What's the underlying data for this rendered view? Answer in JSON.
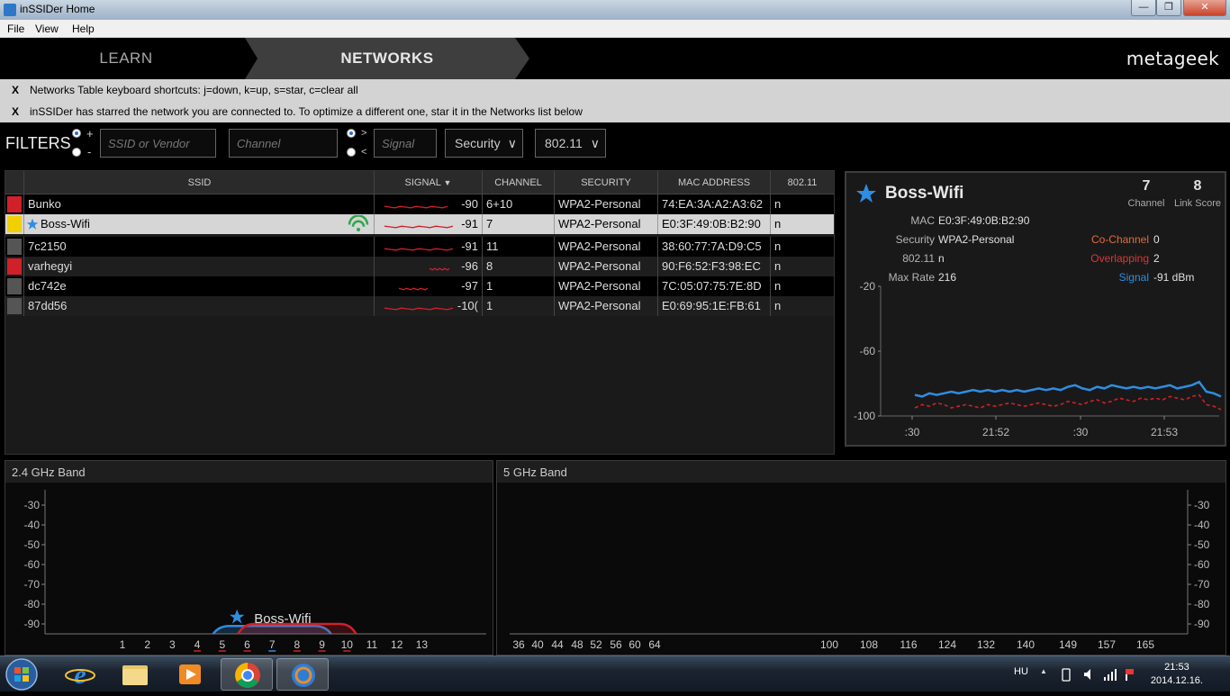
{
  "window": {
    "title": "inSSIDer Home",
    "controls": {
      "minimize": "—",
      "maximize": "❐",
      "close": "✕"
    }
  },
  "menu": [
    "File",
    "View",
    "Help"
  ],
  "nav": {
    "learn": "LEARN",
    "networks": "NETWORKS",
    "brand": "metageek"
  },
  "notices": [
    {
      "close": "X",
      "text": "Networks Table keyboard shortcuts: j=down, k=up, s=star, c=clear all"
    },
    {
      "close": "X",
      "text": "inSSIDer has starred the network you are connected to. To optimize a different one, star it in the Networks list below"
    }
  ],
  "filters": {
    "label": "FILTERS",
    "plus": "+",
    "minus": "-",
    "gt": ">",
    "lt": "<",
    "ssid_placeholder": "SSID or Vendor",
    "channel_placeholder": "Channel",
    "signal_placeholder": "Signal",
    "security": "Security",
    "standard": "802.11",
    "dropdown_arrow": "∨"
  },
  "table": {
    "headers": {
      "ssid": "SSID",
      "signal": "SIGNAL",
      "channel": "CHANNEL",
      "security": "SECURITY",
      "mac": "MAC ADDRESS",
      "standard": "802.11"
    },
    "rows": [
      {
        "color": "#d0202a",
        "ssid": "Bunko",
        "signal": "-90",
        "channel": "6+10",
        "security": "WPA2-Personal",
        "mac": "74:EA:3A:A2:A3:62",
        "standard": "n",
        "starred": false
      },
      {
        "color": "#f2d000",
        "ssid": "Boss-Wifi",
        "signal": "-91",
        "channel": "7",
        "security": "WPA2-Personal",
        "mac": "E0:3F:49:0B:B2:90",
        "standard": "n",
        "starred": true
      },
      {
        "color": "#555555",
        "ssid": "7c2150",
        "signal": "-91",
        "channel": "11",
        "security": "WPA2-Personal",
        "mac": "38:60:77:7A:D9:C5",
        "standard": "n",
        "starred": false
      },
      {
        "color": "#d0202a",
        "ssid": "varhegyi",
        "signal": "-96",
        "channel": "8",
        "security": "WPA2-Personal",
        "mac": "90:F6:52:F3:98:EC",
        "standard": "n",
        "starred": false
      },
      {
        "color": "#555555",
        "ssid": "dc742e",
        "signal": "-97",
        "channel": "1",
        "security": "WPA2-Personal",
        "mac": "7C:05:07:75:7E:8D",
        "standard": "n",
        "starred": false
      },
      {
        "color": "#555555",
        "ssid": "87dd56",
        "signal": "-10(",
        "channel": "1",
        "security": "WPA2-Personal",
        "mac": "E0:69:95:1E:FB:61",
        "standard": "n",
        "starred": false
      }
    ]
  },
  "details": {
    "ssid": "Boss-Wifi",
    "channel_value": "7",
    "channel_label": "Channel",
    "link_score_value": "8",
    "link_score_label": "Link Score",
    "mac_label": "MAC",
    "mac": "E0:3F:49:0B:B2:90",
    "security_label": "Security",
    "security": "WPA2-Personal",
    "standard_label": "802.11",
    "standard": "n",
    "max_rate_label": "Max Rate",
    "max_rate": "216",
    "co_channel_label": "Co-Channel",
    "co_channel": "0",
    "overlapping_label": "Overlapping",
    "overlapping": "2",
    "signal_label": "Signal",
    "signal": "-91 dBm",
    "colors": {
      "signal": "#2f8de0",
      "co_channel": "#e46a3a",
      "overlapping": "#e03535"
    }
  },
  "chart_data": [
    {
      "type": "line",
      "yticks": [
        "-20",
        "-60",
        "-100"
      ],
      "ylim": [
        -100,
        -20
      ],
      "xticks": [
        ":30",
        "21:52",
        ":30",
        "21:53"
      ],
      "series": [
        {
          "color": "#2f8de0",
          "values": [
            -87,
            -88,
            -86,
            -87,
            -86,
            -85,
            -86,
            -85,
            -84,
            -85,
            -84,
            -85,
            -84,
            -85,
            -84,
            -85,
            -84,
            -83,
            -84,
            -83,
            -84,
            -82,
            -81,
            -83,
            -84,
            -82,
            -83,
            -81,
            -82,
            -83,
            -82,
            -83,
            -82,
            -83,
            -82,
            -81,
            -83,
            -82,
            -81,
            -79,
            -85,
            -86,
            -88
          ]
        },
        {
          "color": "#d0202a",
          "dashed": true,
          "values": [
            -95,
            -93,
            -94,
            -92,
            -93,
            -95,
            -94,
            -93,
            -94,
            -95,
            -93,
            -94,
            -93,
            -92,
            -93,
            -94,
            -93,
            -92,
            -93,
            -94,
            -93,
            -91,
            -92,
            -93,
            -91,
            -90,
            -92,
            -91,
            -89,
            -90,
            -91,
            -89,
            -90,
            -89,
            -90,
            -88,
            -89,
            -90,
            -88,
            -87,
            -93,
            -94,
            -96
          ]
        }
      ]
    },
    {
      "type": "area",
      "title": "2.4 GHz Band",
      "yticks": [
        "-30",
        "-40",
        "-50",
        "-60",
        "-70",
        "-80",
        "-90"
      ],
      "ylim": [
        -95,
        -25
      ],
      "categories": [
        "1",
        "2",
        "3",
        "4",
        "5",
        "6",
        "7",
        "8",
        "9",
        "10",
        "11",
        "12",
        "13"
      ],
      "highlighted_categories": [
        "4",
        "5",
        "6",
        "7",
        "8",
        "9",
        "10"
      ],
      "highlight_colors": {
        "4": "#d0202a",
        "5": "#d0202a",
        "6": "#d0202a",
        "7": "#2f8de0",
        "8": "#d0202a",
        "9": "#d0202a",
        "10": "#d0202a"
      },
      "networks": [
        {
          "ssid": "Boss-Wifi",
          "starred": true,
          "color": "#2f8de0",
          "channel": 7,
          "signal": -91
        },
        {
          "color": "#d0202a",
          "channel": 8,
          "signal": -90
        }
      ]
    },
    {
      "type": "area",
      "title": "5 GHz Band",
      "yticks": [
        "-30",
        "-40",
        "-50",
        "-60",
        "-70",
        "-80",
        "-90"
      ],
      "ylim": [
        -95,
        -25
      ],
      "categories": [
        "36",
        "40",
        "44",
        "48",
        "52",
        "56",
        "60",
        "64",
        "100",
        "108",
        "116",
        "124",
        "132",
        "140",
        "149",
        "157",
        "165"
      ]
    }
  ],
  "taskbar": {
    "items": [
      "start-orb",
      "internet-explorer",
      "file-explorer",
      "media-player",
      "chrome",
      "inssider"
    ],
    "tray": {
      "language": "HU",
      "up_arrow": "▲"
    },
    "clock": {
      "time": "21:53",
      "date": "2014.12.16."
    }
  }
}
